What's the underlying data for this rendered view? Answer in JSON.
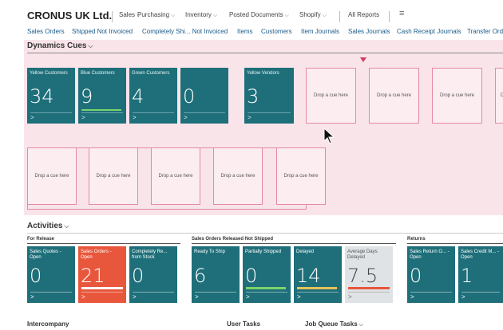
{
  "header": {
    "company": "CRONUS UK Ltd.",
    "menus": [
      "Sales",
      "Purchasing",
      "Inventory",
      "Posted Documents",
      "Shopify"
    ],
    "all_reports": "All Reports",
    "hamburger": "≡"
  },
  "nav": {
    "links": [
      "Sales Orders",
      "Shipped Not Invoiced",
      "Completely Shi... Not Invoiced",
      "Items",
      "Customers",
      "Item Journals",
      "Sales Journals",
      "Cash Receipt Journals",
      "Transfer Ord"
    ]
  },
  "dynamics_cues": {
    "title": "Dynamics Cues",
    "tiles": [
      {
        "label": "Yellow Customers",
        "value": "34"
      },
      {
        "label": "Blue Customers",
        "value": "9"
      },
      {
        "label": "Green Customers",
        "value": "4"
      },
      {
        "label": "",
        "value": "0"
      },
      {
        "label": "Yellow Vendors",
        "value": "3"
      }
    ],
    "drop_label": "Drop a cue here",
    "colors": {
      "tile": "#1e6f7a",
      "green_bar": "#7bd36a",
      "drop_border": "#e58aa2"
    }
  },
  "activities": {
    "title": "Activities",
    "groups": [
      {
        "title": "For Release"
      },
      {
        "title": "Sales Orders Released Not Shipped"
      },
      {
        "title": "Returns"
      }
    ],
    "tiles": [
      {
        "label": "Sales Quotes - Open",
        "value": "0"
      },
      {
        "label": "Sales Orders - Open",
        "value": "21"
      },
      {
        "label": "Completely Re... from Stock",
        "value": "0"
      },
      {
        "label": "Ready To Ship",
        "value": "6"
      },
      {
        "label": "Partially Shipped",
        "value": "0"
      },
      {
        "label": "Delayed",
        "value": "14"
      },
      {
        "label": "Average Days Delayed",
        "value": "7.5"
      },
      {
        "label": "Sales Return O... - Open",
        "value": "0"
      },
      {
        "label": "Sales Credit M... - Open",
        "value": "1"
      }
    ]
  },
  "bottom": {
    "intercompany": "Intercompany",
    "user_tasks": "User Tasks",
    "job_queue": "Job Queue Tasks"
  },
  "icons": {
    "chevron": "⌵",
    "arrow": ">"
  }
}
